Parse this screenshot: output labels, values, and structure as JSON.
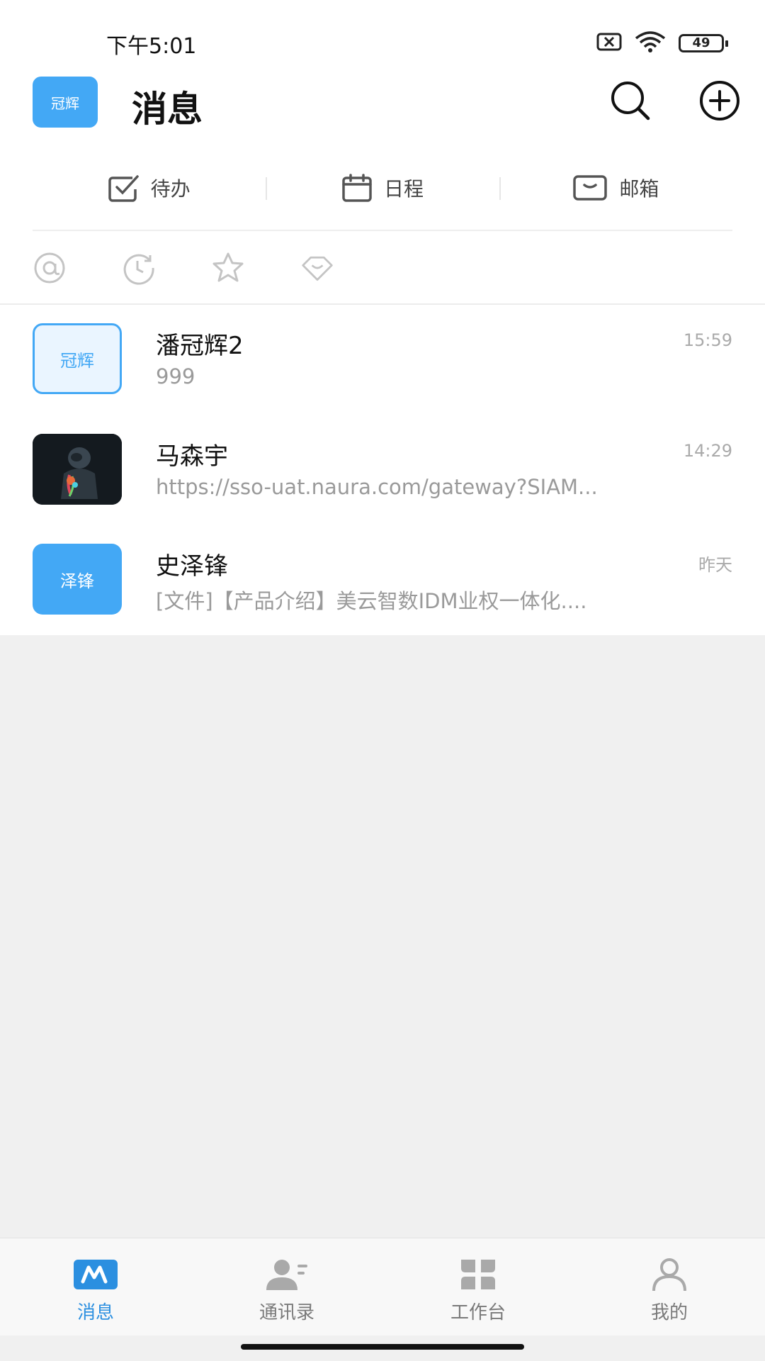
{
  "status_bar": {
    "time": "下午5:01",
    "battery": "49"
  },
  "header": {
    "avatar_text": "冠辉",
    "title": "消息"
  },
  "quick_actions": [
    {
      "label": "待办",
      "icon": "todo-check-icon"
    },
    {
      "label": "日程",
      "icon": "calendar-icon"
    },
    {
      "label": "邮箱",
      "icon": "mail-icon"
    }
  ],
  "filters": [
    "at-mention-icon",
    "recent-clock-icon",
    "star-icon",
    "heart-icon"
  ],
  "conversations": [
    {
      "avatar_text": "冠辉",
      "name": "潘冠辉2",
      "time": "15:59",
      "preview": "999"
    },
    {
      "avatar_text": "",
      "name": "马森宇",
      "time": "14:29",
      "preview": "https://sso-uat.naura.com/gateway?SIAM..."
    },
    {
      "avatar_text": "泽锋",
      "name": "史泽锋",
      "time": "昨天",
      "preview": "[文件]【产品介绍】美云智数IDM业权一体化...."
    }
  ],
  "tabs": [
    {
      "label": "消息",
      "active": true
    },
    {
      "label": "通讯录",
      "active": false
    },
    {
      "label": "工作台",
      "active": false
    },
    {
      "label": "我的",
      "active": false
    }
  ],
  "colors": {
    "accent": "#43a8f5",
    "active_tab": "#2b8fe0",
    "background": "#f0f0f0"
  }
}
